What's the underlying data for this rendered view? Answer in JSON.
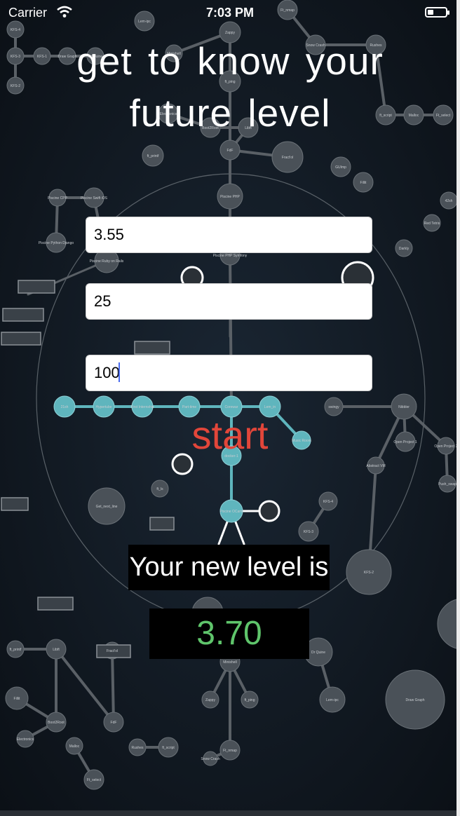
{
  "status_bar": {
    "carrier": "Carrier",
    "time": "7:03 PM",
    "wifi_icon": "wifi-icon",
    "battery_icon": "battery-icon"
  },
  "title": {
    "line1": "get to know your",
    "line2": "future level"
  },
  "form": {
    "field1_value": "3.55",
    "field2_value": "25",
    "field3_value": "100"
  },
  "start_label": "start",
  "result": {
    "label": "Your new level is",
    "value": "3.70"
  },
  "colors": {
    "background": "#0e151c",
    "node": "#4a5158",
    "node_highlight": "#5fb5bd",
    "start": "#e2463a",
    "result_value": "#5fc56b"
  },
  "background_graph": {
    "labels": [
      "KFS-4",
      "KFS-3",
      "KFS-2",
      "KFS-1",
      "Draw Graph",
      "Dr Quine",
      "Lem-ipc",
      "Minishell",
      "Zappy",
      "ft_ping",
      "Ft_nmap",
      "Snow Crash",
      "Rushes",
      "ft_script",
      "Malloc",
      "Ft_select",
      "Electronics",
      "Boot2Root",
      "Libft",
      "ft_printf",
      "FdF",
      "Fract'ol",
      "GUImp",
      "Fillit",
      "Piscine PHP",
      "Piscine CPP",
      "Piscine Swift iOS",
      "Piscine Python Django",
      "Piscine Ruby on Rails",
      "Piscine PHP Symfony",
      "Darkly",
      "Red Tetris",
      "42sh",
      "21sh",
      "Hypertube",
      "First Internship",
      "Part-time",
      "Corewar",
      "Lem_in",
      "docker-1",
      "Piscine OCaml",
      "Music Room",
      "swingy",
      "Nibbler",
      "Abstract VM",
      "Open Project 1",
      "Open Project 2",
      "Push_swap",
      "ft_ls",
      "Get_next_line"
    ]
  }
}
